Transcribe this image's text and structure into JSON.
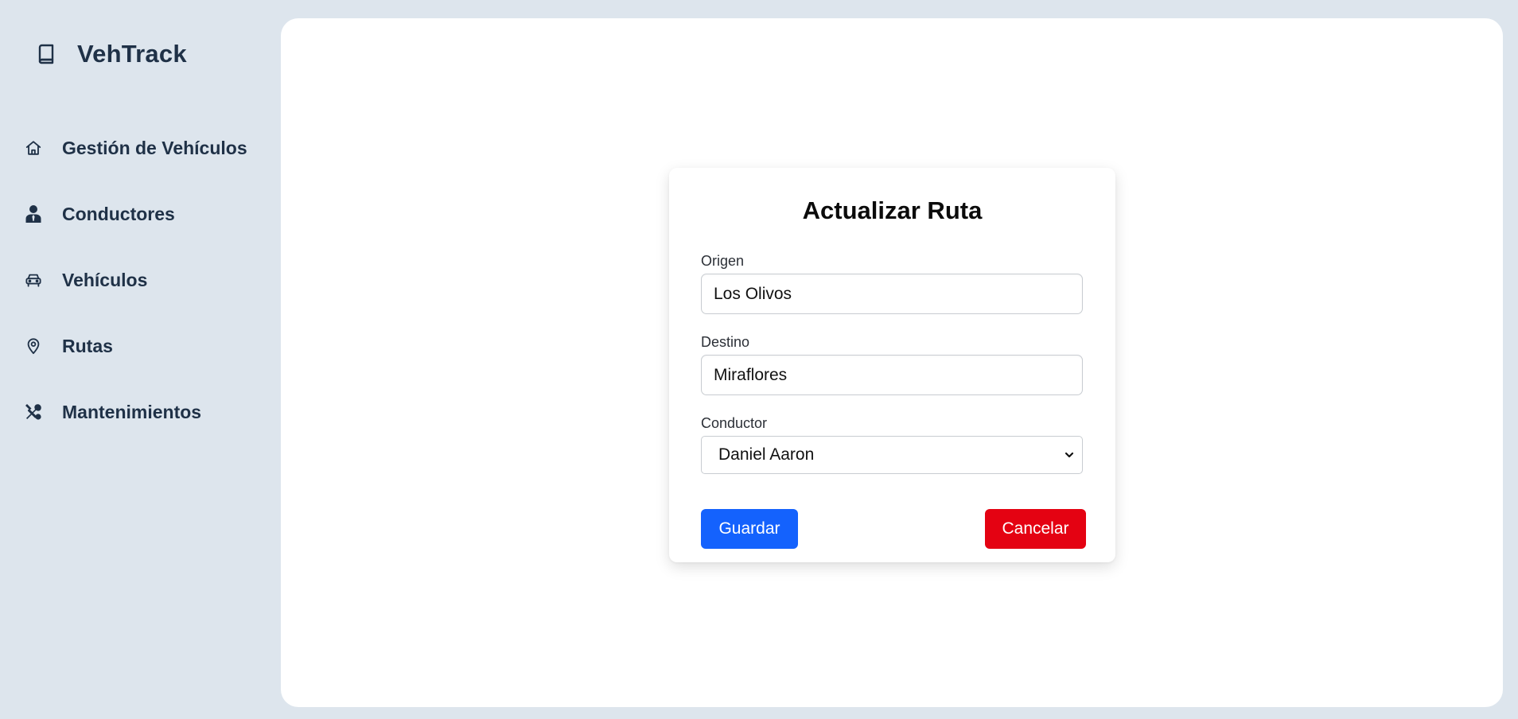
{
  "app": {
    "title": "VehTrack",
    "brand_icon": "book-icon"
  },
  "sidebar": {
    "items": [
      {
        "label": "Gestión de Vehículos",
        "icon": "home-icon"
      },
      {
        "label": "Conductores",
        "icon": "user-tie-icon"
      },
      {
        "label": "Vehículos",
        "icon": "car-icon"
      },
      {
        "label": "Rutas",
        "icon": "map-pin-icon"
      },
      {
        "label": "Mantenimientos",
        "icon": "tools-icon"
      }
    ]
  },
  "form": {
    "title": "Actualizar Ruta",
    "origen": {
      "label": "Origen",
      "value": "Los Olivos"
    },
    "destino": {
      "label": "Destino",
      "value": "Miraflores"
    },
    "conductor": {
      "label": "Conductor",
      "selected": "Daniel Aaron"
    },
    "save_label": "Guardar",
    "cancel_label": "Cancelar"
  },
  "colors": {
    "background": "#dde5ed",
    "text_dark": "#1f3147",
    "primary": "#1462fd",
    "danger": "#e40212",
    "panel": "#ffffff"
  }
}
